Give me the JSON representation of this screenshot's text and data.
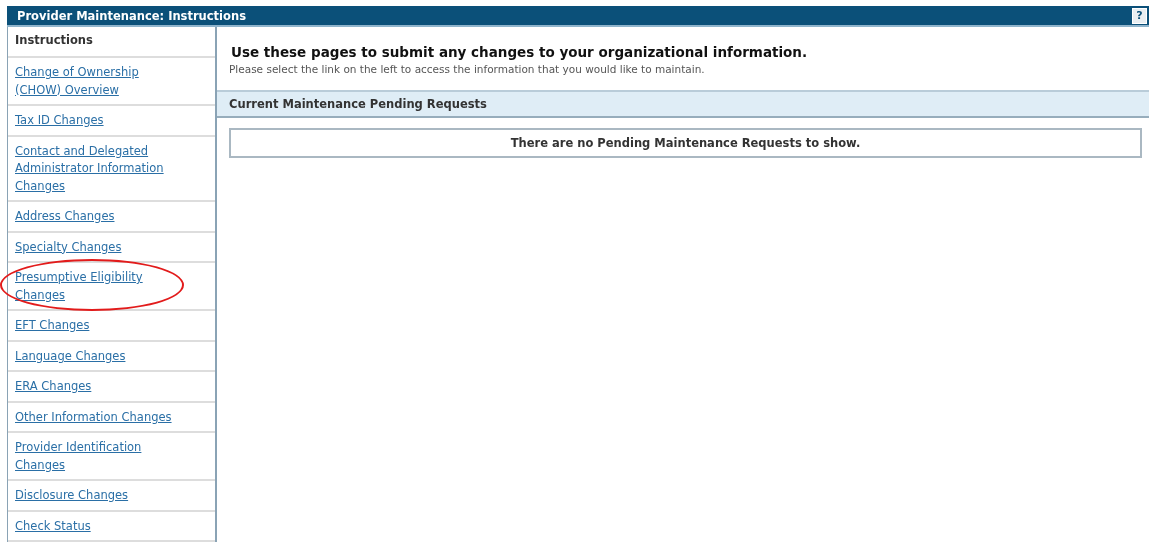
{
  "window": {
    "title": "Provider Maintenance: Instructions",
    "help": "?"
  },
  "sidebar": {
    "header": "Instructions",
    "items": [
      {
        "label": "Change of Ownership (CHOW) Overview",
        "highlighted": false
      },
      {
        "label": "Tax ID Changes",
        "highlighted": false
      },
      {
        "label": "Contact and Delegated Administrator Information Changes",
        "highlighted": false
      },
      {
        "label": "Address Changes",
        "highlighted": false
      },
      {
        "label": "Specialty Changes",
        "highlighted": false
      },
      {
        "label": "Presumptive Eligibility Changes",
        "highlighted": true
      },
      {
        "label": "EFT Changes",
        "highlighted": false
      },
      {
        "label": "Language Changes",
        "highlighted": false
      },
      {
        "label": "ERA Changes",
        "highlighted": false
      },
      {
        "label": "Other Information Changes",
        "highlighted": false
      },
      {
        "label": "Provider Identification Changes",
        "highlighted": false
      },
      {
        "label": "Disclosure Changes",
        "highlighted": false
      },
      {
        "label": "Check Status",
        "highlighted": false
      }
    ]
  },
  "main": {
    "heading": "Use these pages to submit any changes to your organizational information.",
    "subtitle": "Please select the link on the left to access the information that you would like to maintain.",
    "section_title": "Current Maintenance Pending Requests",
    "empty_message": "There are no Pending Maintenance Requests to show."
  }
}
